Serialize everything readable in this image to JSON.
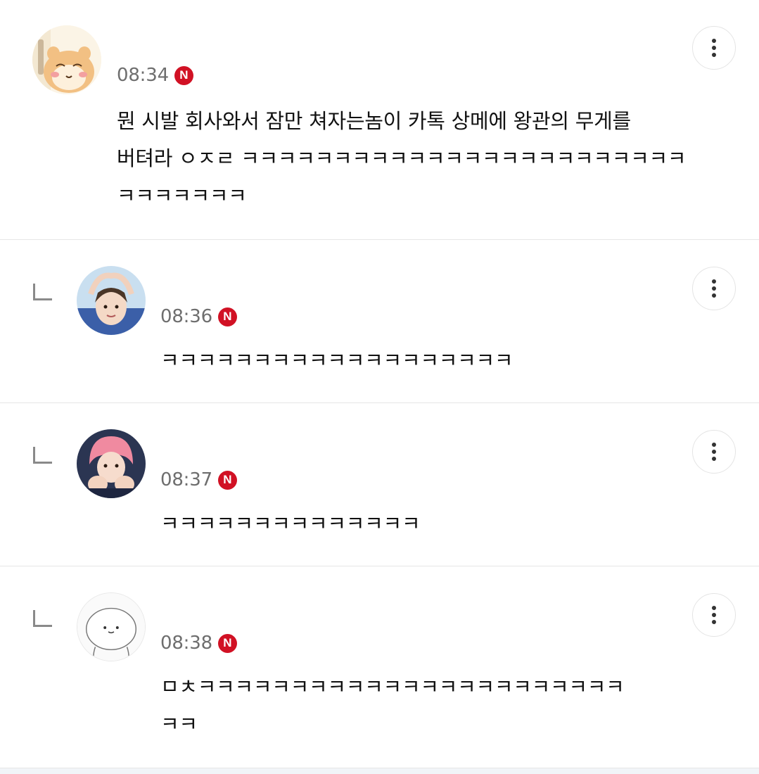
{
  "comments": [
    {
      "time": "08:34",
      "badge": "N",
      "lines": [
        "뭔 시발 회사와서 잠만 쳐자는놈이 카톡 상메에 왕관의 무게를",
        "버텨라 ㅇㅈㄹ ㅋㅋㅋㅋㅋㅋㅋㅋㅋㅋㅋㅋㅋㅋㅋㅋㅋㅋㅋㅋㅋㅋㅋㅋ",
        "ㅋㅋㅋㅋㅋㅋㅋ"
      ],
      "avatar_icon": "hamster-avatar-icon"
    },
    {
      "time": "08:36",
      "badge": "N",
      "lines": [
        "ㅋㅋㅋㅋㅋㅋㅋㅋㅋㅋㅋㅋㅋㅋㅋㅋㅋㅋㅋ"
      ],
      "avatar_icon": "person-heart-hands-avatar-icon"
    },
    {
      "time": "08:37",
      "badge": "N",
      "lines": [
        "ㅋㅋㅋㅋㅋㅋㅋㅋㅋㅋㅋㅋㅋㅋ"
      ],
      "avatar_icon": "pink-hair-person-avatar-icon"
    },
    {
      "time": "08:38",
      "badge": "N",
      "lines": [
        "ㅁㅊㅋㅋㅋㅋㅋㅋㅋㅋㅋㅋㅋㅋㅋㅋㅋㅋㅋㅋㅋㅋㅋㅋㅋ",
        "ㅋㅋ"
      ],
      "avatar_icon": "line-drawing-character-avatar-icon"
    }
  ],
  "colors": {
    "badge_red": "#d11124",
    "time_gray": "#6e6e6e",
    "divider": "#e6e6e6"
  },
  "icons": {
    "more": "more-vertical-icon",
    "reply": "reply-indent-icon",
    "new": "new-badge-icon"
  }
}
